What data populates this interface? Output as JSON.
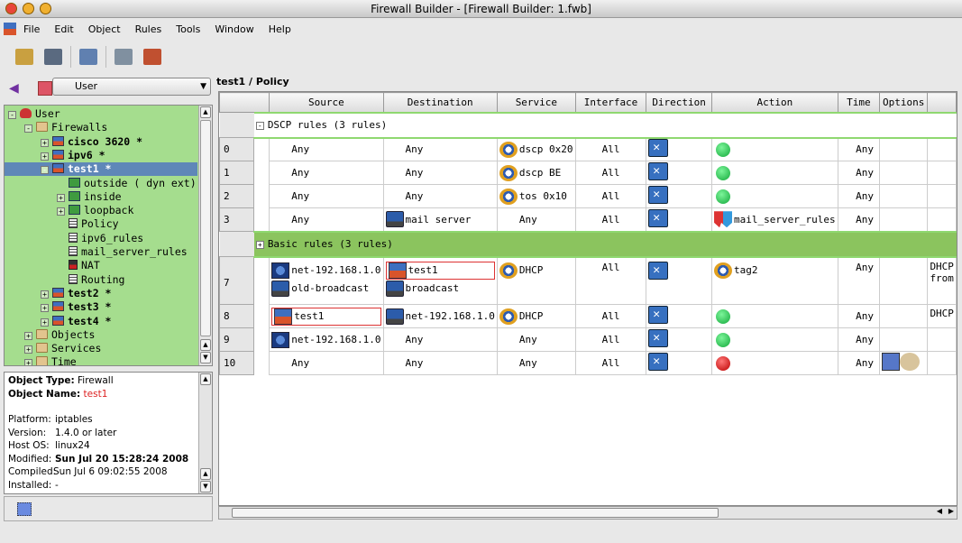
{
  "window": {
    "title": "Firewall Builder - [Firewall Builder: 1.fwb]"
  },
  "menu": [
    "File",
    "Edit",
    "Object",
    "Rules",
    "Tools",
    "Window",
    "Help"
  ],
  "toolbar": [
    {
      "icon": "open-icon"
    },
    {
      "icon": "save-icon"
    },
    {
      "icon": "find-icon"
    },
    {
      "icon": "compile-icon"
    },
    {
      "icon": "install-icon"
    }
  ],
  "left": {
    "library": "User",
    "tree": [
      {
        "label": "User",
        "level": 0,
        "icon": "library",
        "exp": "-"
      },
      {
        "label": "Firewalls",
        "level": 1,
        "icon": "folder",
        "exp": "-"
      },
      {
        "label": "cisco 3620 *",
        "level": 2,
        "icon": "fw",
        "exp": "+",
        "bold": true
      },
      {
        "label": "ipv6 *",
        "level": 2,
        "icon": "fw",
        "exp": "+",
        "bold": true
      },
      {
        "label": "test1 *",
        "level": 2,
        "icon": "fw",
        "exp": "-",
        "bold": true,
        "selected": true
      },
      {
        "label": "outside ( dyn ext)",
        "level": 3,
        "icon": "iface",
        "exp": ""
      },
      {
        "label": "inside",
        "level": 3,
        "icon": "iface",
        "exp": "+"
      },
      {
        "label": "loopback",
        "level": 3,
        "icon": "iface",
        "exp": "+"
      },
      {
        "label": "Policy",
        "level": 3,
        "icon": "doc",
        "exp": ""
      },
      {
        "label": "ipv6_rules",
        "level": 3,
        "icon": "doc",
        "exp": ""
      },
      {
        "label": "mail_server_rules",
        "level": 3,
        "icon": "doc",
        "exp": ""
      },
      {
        "label": "NAT",
        "level": 3,
        "icon": "nat",
        "exp": ""
      },
      {
        "label": "Routing",
        "level": 3,
        "icon": "doc",
        "exp": ""
      },
      {
        "label": "test2 *",
        "level": 2,
        "icon": "fw",
        "exp": "+",
        "bold": true
      },
      {
        "label": "test3 *",
        "level": 2,
        "icon": "fw",
        "exp": "+",
        "bold": true
      },
      {
        "label": "test4 *",
        "level": 2,
        "icon": "fw",
        "exp": "+",
        "bold": true
      },
      {
        "label": "Objects",
        "level": 1,
        "icon": "folder",
        "exp": "+"
      },
      {
        "label": "Services",
        "level": 1,
        "icon": "folder",
        "exp": "+"
      },
      {
        "label": "Time",
        "level": 1,
        "icon": "folder",
        "exp": "+"
      }
    ],
    "info": {
      "type_label": "Object Type:",
      "type": "Firewall",
      "name_label": "Object Name:",
      "name": "test1",
      "lines": [
        [
          "Platform:",
          "iptables",
          false
        ],
        [
          "Version:",
          "1.4.0 or later",
          false
        ],
        [
          "Host OS:",
          "linux24",
          false
        ],
        [
          "Modified:",
          "Sun Jul 20 15:28:24 2008",
          true
        ],
        [
          "Compiled:",
          "Sun Jul 6 09:02:55 2008",
          false
        ],
        [
          "Installed:",
          "-",
          false
        ]
      ]
    }
  },
  "policy": {
    "breadcrumb": "test1 / Policy",
    "columns": [
      "",
      "Source",
      "Destination",
      "Service",
      "Interface",
      "Direction",
      "Action",
      "Time",
      "Options",
      ""
    ],
    "rows": [
      {
        "group": "DSCP rules (3 rules)",
        "exp": "-"
      },
      {
        "num": "0",
        "src": [
          [
            "Any",
            ""
          ]
        ],
        "dst": [
          [
            "Any",
            ""
          ]
        ],
        "srv": [
          [
            "dscp 0x20",
            "ip"
          ]
        ],
        "itf": "All",
        "act": [
          "accept",
          ""
        ],
        "time": "Any",
        "opt": "",
        "cmt": ""
      },
      {
        "num": "1",
        "src": [
          [
            "Any",
            ""
          ]
        ],
        "dst": [
          [
            "Any",
            ""
          ]
        ],
        "srv": [
          [
            "dscp BE",
            "ip"
          ]
        ],
        "itf": "All",
        "act": [
          "accept",
          ""
        ],
        "time": "Any",
        "opt": "",
        "cmt": ""
      },
      {
        "num": "2",
        "src": [
          [
            "Any",
            ""
          ]
        ],
        "dst": [
          [
            "Any",
            ""
          ]
        ],
        "srv": [
          [
            "tos 0x10",
            "ip"
          ]
        ],
        "itf": "All",
        "act": [
          "accept",
          ""
        ],
        "time": "Any",
        "opt": "",
        "cmt": ""
      },
      {
        "num": "3",
        "src": [
          [
            "Any",
            ""
          ]
        ],
        "dst": [
          [
            "mail server",
            "host"
          ]
        ],
        "srv": [
          [
            "Any",
            ""
          ]
        ],
        "itf": "All",
        "act": [
          "branch",
          "mail_server_rules"
        ],
        "time": "Any",
        "opt": "",
        "cmt": ""
      },
      {
        "group": "Basic rules (3 rules)",
        "exp": "+",
        "basic": true
      },
      {
        "num": "7",
        "tall": true,
        "src": [
          [
            "net-192.168.1.0",
            "net"
          ],
          [
            "old-broadcast",
            "host"
          ]
        ],
        "dst": [
          [
            "test1",
            "fw",
            true
          ],
          [
            "broadcast",
            "host"
          ]
        ],
        "srv": [
          [
            "DHCP",
            "svc"
          ]
        ],
        "itf": "All",
        "act": [
          "tag",
          "tag2"
        ],
        "time": "Any",
        "opt": "",
        "cmt": "DHCP from"
      },
      {
        "num": "8",
        "src": [
          [
            "test1",
            "fw",
            true
          ]
        ],
        "dst": [
          [
            "net-192.168.1.0",
            "host"
          ]
        ],
        "srv": [
          [
            "DHCP",
            "svc"
          ]
        ],
        "itf": "All",
        "act": [
          "accept",
          ""
        ],
        "time": "Any",
        "opt": "",
        "cmt": "DHCP"
      },
      {
        "num": "9",
        "src": [
          [
            "net-192.168.1.0",
            "net"
          ]
        ],
        "dst": [
          [
            "Any",
            ""
          ]
        ],
        "srv": [
          [
            "Any",
            ""
          ]
        ],
        "itf": "All",
        "act": [
          "accept",
          ""
        ],
        "time": "Any",
        "opt": "",
        "cmt": ""
      },
      {
        "num": "10",
        "src": [
          [
            "Any",
            ""
          ]
        ],
        "dst": [
          [
            "Any",
            ""
          ]
        ],
        "srv": [
          [
            "Any",
            ""
          ]
        ],
        "itf": "All",
        "act": [
          "deny",
          ""
        ],
        "time": "Any",
        "opt": "log",
        "cmt": ""
      }
    ]
  },
  "colors": {
    "tree_bg": "#a5dd8e",
    "group_bg": "#8bc45e",
    "selection": "#5f87b8",
    "accept": "#13a83a",
    "deny": "#b00000"
  }
}
